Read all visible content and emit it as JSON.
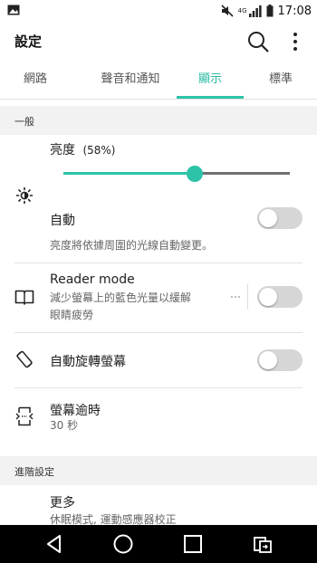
{
  "status_bar": {
    "time": "17:08",
    "network": "4G",
    "icons": [
      "image-notification-icon",
      "mute-icon",
      "signal-icon",
      "battery-icon"
    ]
  },
  "app_bar": {
    "title": "設定",
    "icons": [
      "search-icon",
      "more-vert-icon"
    ]
  },
  "tabs": [
    {
      "label": "網路",
      "active": false
    },
    {
      "label": "聲音和通知",
      "active": false
    },
    {
      "label": "顯示",
      "active": true
    },
    {
      "label": "標準",
      "active": false
    }
  ],
  "sections": {
    "general": "一般",
    "advanced": "進階設定"
  },
  "brightness": {
    "label": "亮度",
    "percent_text": "(58%)",
    "value": 0.58,
    "auto_label": "自動",
    "auto_on": false,
    "auto_desc": "亮度將依據周圍的光線自動變更。",
    "icon": "brightness-icon"
  },
  "reader_mode": {
    "title": "Reader mode",
    "desc_line1": "減少螢幕上的藍色光量以緩解",
    "desc_line2": "眼睛疲勞",
    "on": false,
    "icon": "book-icon"
  },
  "auto_rotate": {
    "label": "自動旋轉螢幕",
    "on": false,
    "icon": "screen-rotation-icon"
  },
  "screen_timeout": {
    "label": "螢幕逾時",
    "value": "30 秒",
    "icon": "screen-timeout-icon"
  },
  "more": {
    "label": "更多",
    "desc": "休眠模式, 運動感應器校正"
  },
  "colors": {
    "accent": "#2cc3a8",
    "nav_bar": "#000000",
    "section_bg": "#f2f2f2"
  },
  "nav_bar": {
    "icons": [
      "back-icon",
      "home-icon",
      "recents-icon",
      "dual-window-icon"
    ]
  }
}
